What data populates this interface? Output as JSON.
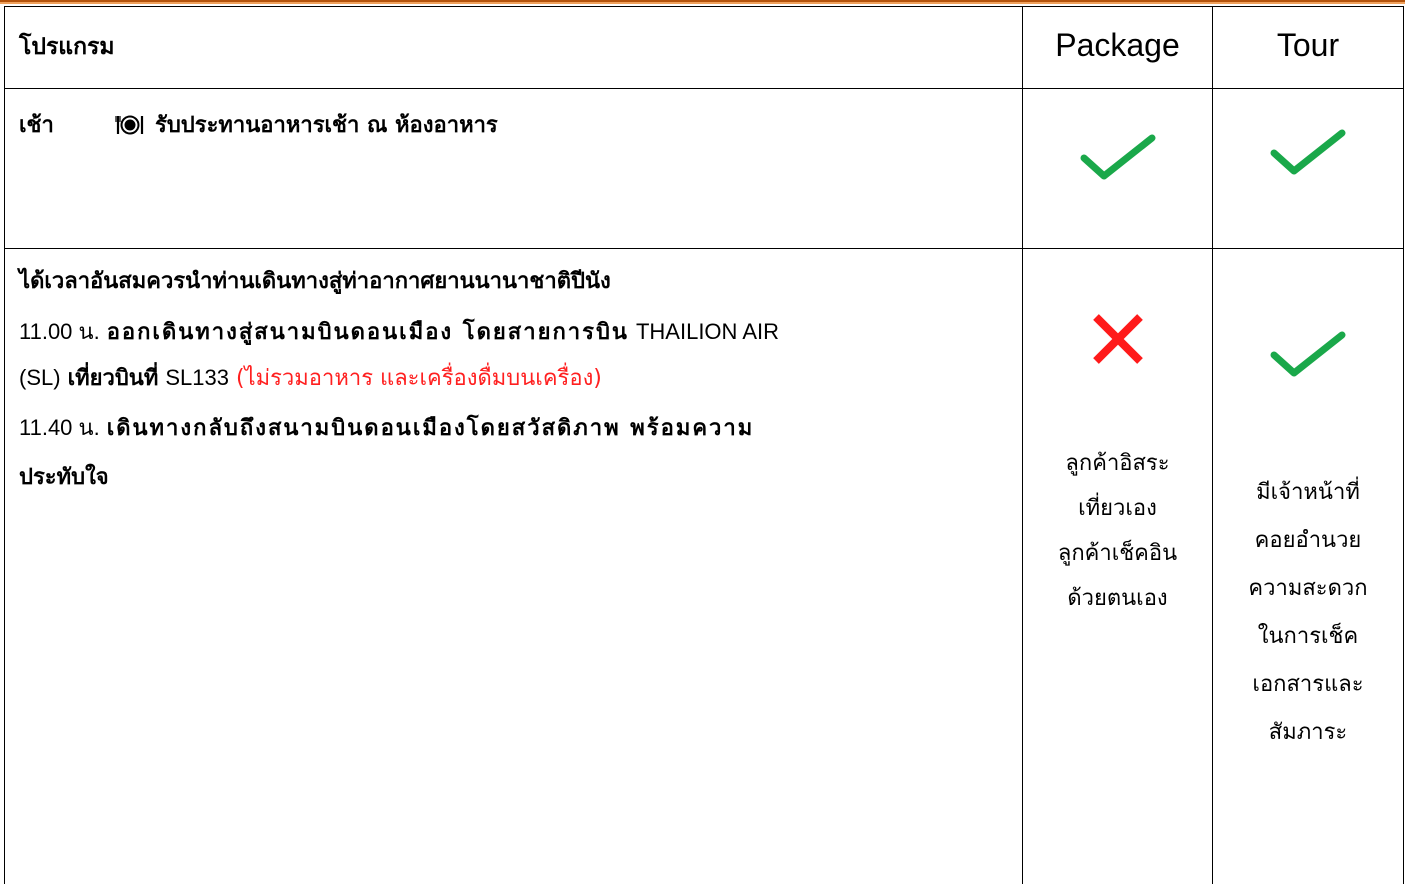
{
  "table": {
    "header": {
      "program_label": "โปรแกรม",
      "package_label": "Package",
      "tour_label": "Tour"
    },
    "breakfast_row": {
      "time": "เช้า",
      "icon": "dining-plate-icon",
      "text": "รับประทานอาหารเช้า ณ ห้องอาหาร",
      "package": "check",
      "tour": "check"
    },
    "departure_row": {
      "line1": "ได้เวลาอันสมควรนำท่านเดินทางสู่ท่าอากาศยานนานาชาติปีนัง",
      "line2_time": "11.00 น.",
      "line2_text": "ออกเดินทางสู่สนามบินดอนเมือง โดยสายการบิน",
      "line2_airline": "THAILION AIR",
      "line3_code": "(SL)",
      "line3_flight_label": "เที่ยวบินที่",
      "line3_flight": "SL133",
      "line3_note": "(ไม่รวมอาหาร และเครื่องดื่มบนเครื่อง)",
      "line4_time": "11.40 น.",
      "line4_text": "เดินทางกลับถึงสนามบินดอนเมืองโดยสวัสดิภาพ พร้อมความ",
      "line5_text": "ประทับใจ",
      "package": "cross",
      "tour": "check",
      "package_note": [
        "ลูกค้าอิสระ",
        "เที่ยวเอง",
        "ลูกค้าเช็คอิน",
        "ด้วยตนเอง"
      ],
      "tour_note": [
        "มีเจ้าหน้าที่",
        "คอยอำนวย",
        "ความสะดวก",
        "ในการเช็ค",
        "เอกสารและ",
        "สัมภาระ"
      ]
    }
  },
  "colors": {
    "check": "#1aa84a",
    "cross": "#ff1a1a",
    "note_red": "#ff2020",
    "topbar_dark": "#b4530c",
    "topbar_light": "#f0a15c"
  }
}
